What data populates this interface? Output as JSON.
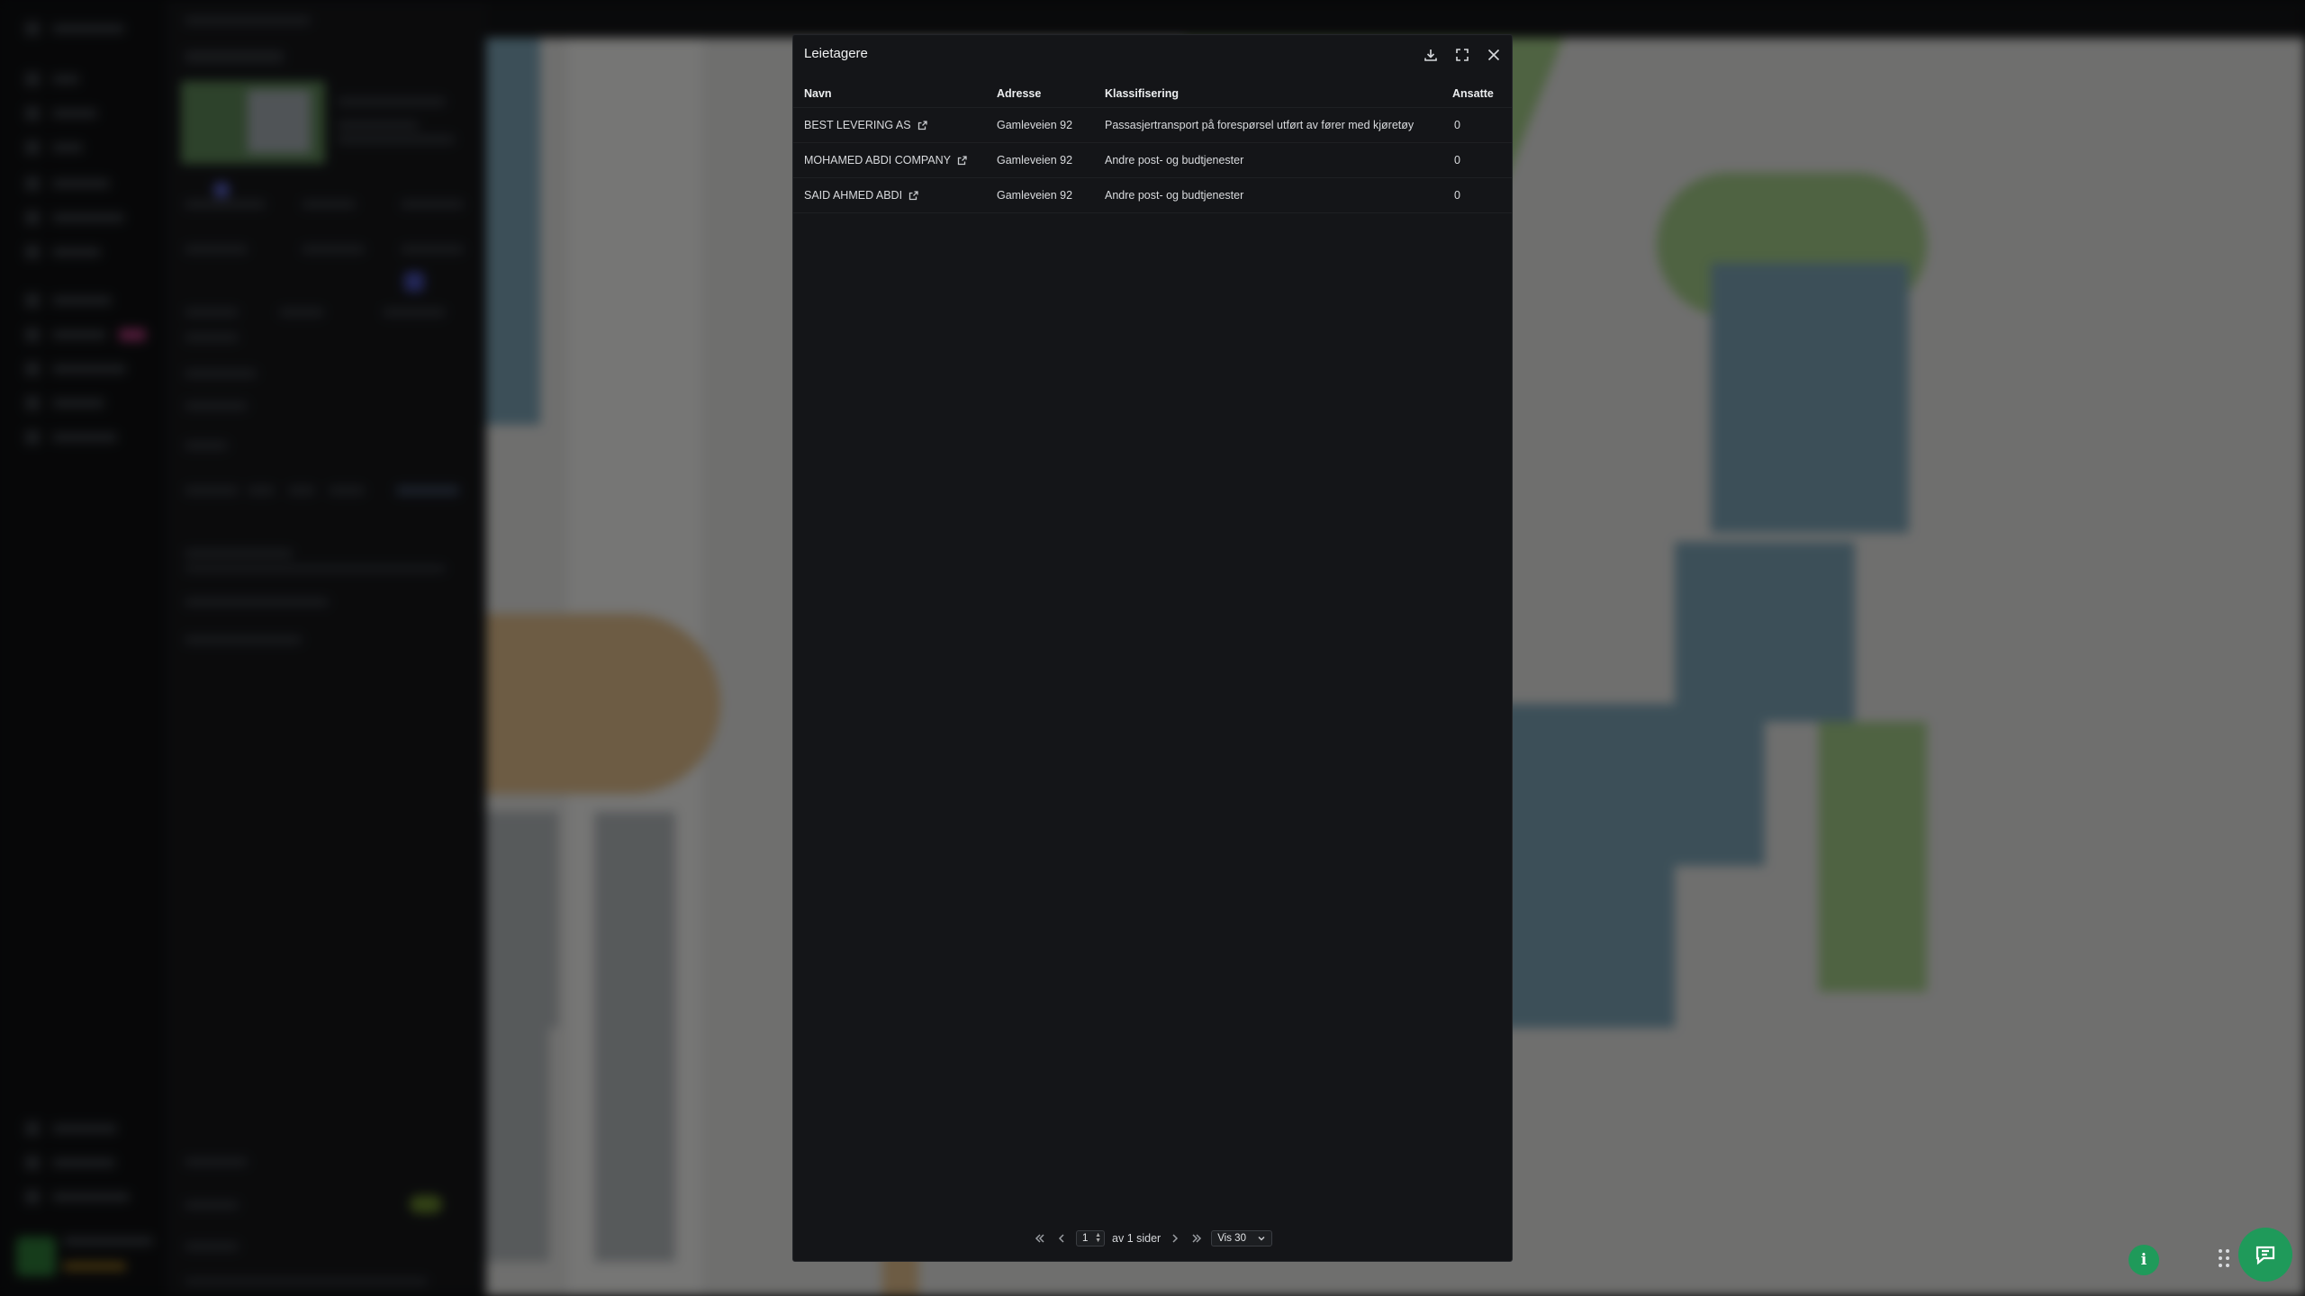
{
  "modal": {
    "title": "Leietagere",
    "columns": {
      "name": "Navn",
      "address": "Adresse",
      "classification": "Klassifisering",
      "employees": "Ansatte"
    },
    "rows": [
      {
        "name": "BEST LEVERING AS",
        "address": "Gamleveien 92",
        "classification": "Passasjertransport på forespørsel utført av fører med kjøretøy",
        "employees": "0"
      },
      {
        "name": "MOHAMED ABDI COMPANY",
        "address": "Gamleveien 92",
        "classification": "Andre post- og budtjenester",
        "employees": "0"
      },
      {
        "name": "SAID AHMED ABDI",
        "address": "Gamleveien 92",
        "classification": "Andre post- og budtjenester",
        "employees": "0"
      }
    ],
    "pagination": {
      "current_page": "1",
      "of_pages_label": "av 1 sider",
      "page_size_label": "Vis 30"
    }
  },
  "icons": {
    "download": "download-icon",
    "expand": "expand-icon",
    "close": "close-icon",
    "external_link": "external-link-icon",
    "info": "info-icon",
    "chat": "chat-icon"
  },
  "colors": {
    "accent_green": "#1f9a5a",
    "modal_bg": "#141518"
  }
}
